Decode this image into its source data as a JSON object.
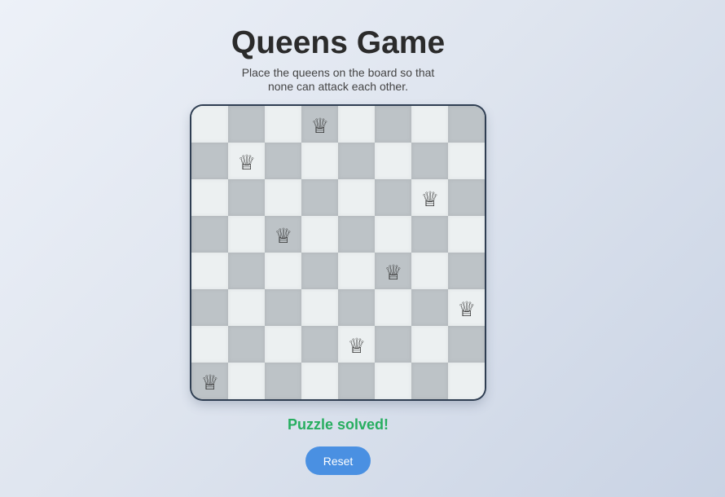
{
  "header": {
    "title": "Queens Game",
    "subtitle": "Place the queens on the board so that none can attack each other."
  },
  "board": {
    "size": 8,
    "queen_symbol": "♕",
    "queen_columns_by_row": [
      3,
      1,
      6,
      2,
      5,
      7,
      4,
      0
    ],
    "colors": {
      "light": "#ecf0f1",
      "dark": "#bdc3c7",
      "border": "#2f3e52"
    }
  },
  "status": {
    "text": "Puzzle solved!",
    "color": "#27ae60"
  },
  "controls": {
    "reset_label": "Reset",
    "reset_color": "#4a90e2"
  }
}
